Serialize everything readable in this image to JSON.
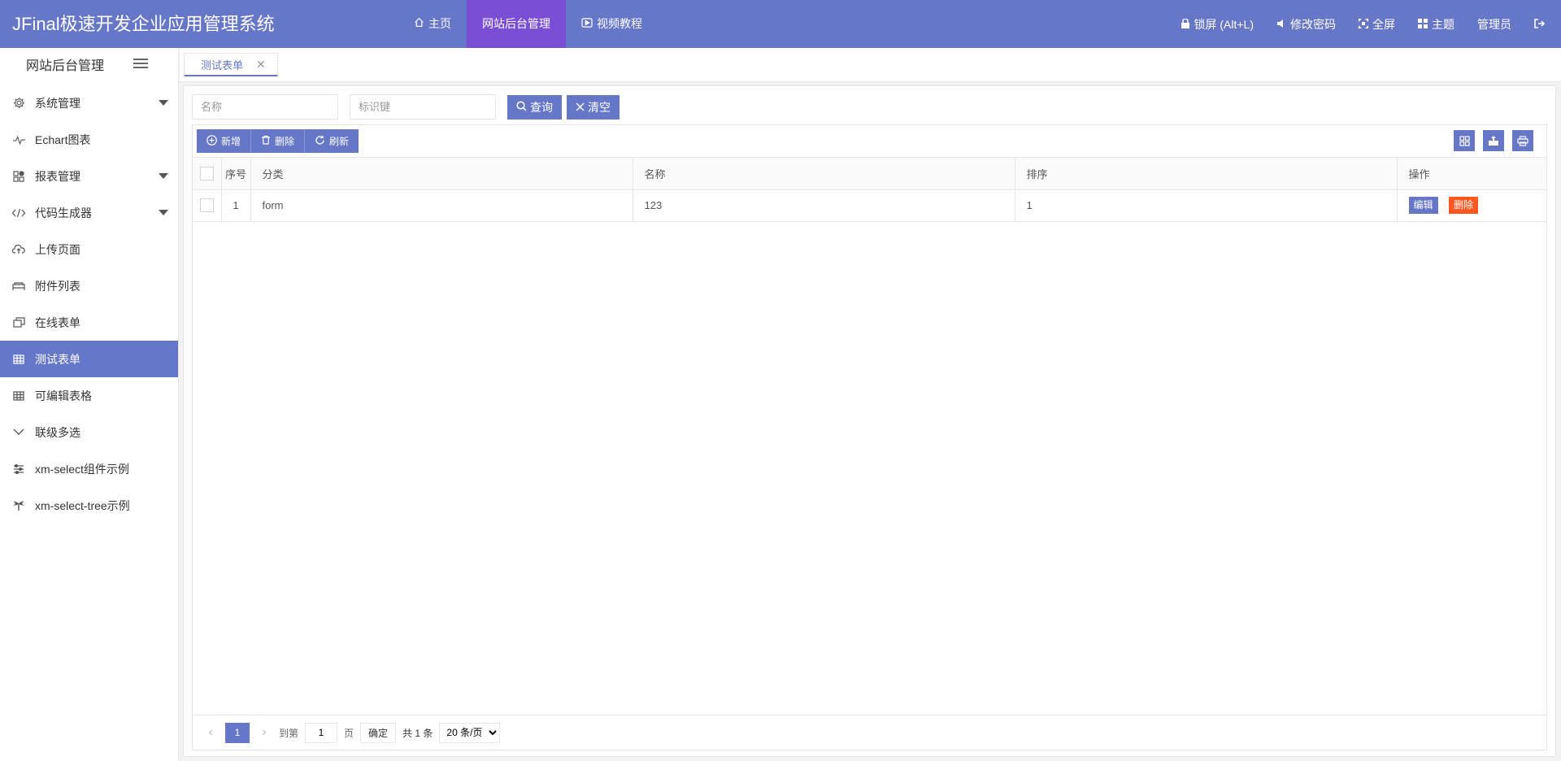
{
  "app": {
    "title": "JFinal极速开发企业应用管理系统"
  },
  "topnav": [
    {
      "label": "主页",
      "icon": "home-icon"
    },
    {
      "label": "网站后台管理",
      "icon": ""
    },
    {
      "label": "视频教程",
      "icon": "video-icon"
    }
  ],
  "topright": {
    "lock": "锁屏 (Alt+L)",
    "password": "修改密码",
    "fullscreen": "全屏",
    "theme": "主题",
    "user": "管理员"
  },
  "sidebar": {
    "title": "网站后台管理",
    "items": [
      {
        "label": "系统管理",
        "icon": "gear-icon",
        "expandable": true
      },
      {
        "label": "Echart图表",
        "icon": "pulse-icon",
        "expandable": false
      },
      {
        "label": "报表管理",
        "icon": "report-icon",
        "expandable": true
      },
      {
        "label": "代码生成器",
        "icon": "code-icon",
        "expandable": true
      },
      {
        "label": "上传页面",
        "icon": "upload-cloud-icon",
        "expandable": false
      },
      {
        "label": "附件列表",
        "icon": "attachment-icon",
        "expandable": false
      },
      {
        "label": "在线表单",
        "icon": "form-icon",
        "expandable": false
      },
      {
        "label": "测试表单",
        "icon": "table-icon",
        "expandable": false,
        "active": true
      },
      {
        "label": "可编辑表格",
        "icon": "table-icon",
        "expandable": false
      },
      {
        "label": "联级多选",
        "icon": "chevron-down-icon",
        "expandable": false
      },
      {
        "label": "xm-select组件示例",
        "icon": "sliders-icon",
        "expandable": false
      },
      {
        "label": "xm-select-tree示例",
        "icon": "tree-icon",
        "expandable": false
      }
    ]
  },
  "tabs": [
    {
      "label": "测试表单",
      "close": "✕"
    }
  ],
  "search": {
    "name_placeholder": "名称",
    "key_placeholder": "标识键",
    "query_label": "查询",
    "clear_label": "清空"
  },
  "toolbar": {
    "add_label": "新增",
    "delete_label": "删除",
    "refresh_label": "刷新"
  },
  "table": {
    "headers": {
      "index": "序号",
      "category": "分类",
      "name": "名称",
      "sort": "排序",
      "actions": "操作"
    },
    "rows": [
      {
        "index": "1",
        "category": "form",
        "name": "123",
        "sort": "1",
        "edit": "编辑",
        "delete": "删除"
      }
    ]
  },
  "pager": {
    "current": "1",
    "goto_label": "到第",
    "goto_value": "1",
    "page_label": "页",
    "ok_label": "确定",
    "total": "共 1 条",
    "page_size": "20 条/页"
  },
  "colors": {
    "primary": "#6777c8",
    "active_top": "#7a4fd6",
    "danger": "#ff5722"
  }
}
